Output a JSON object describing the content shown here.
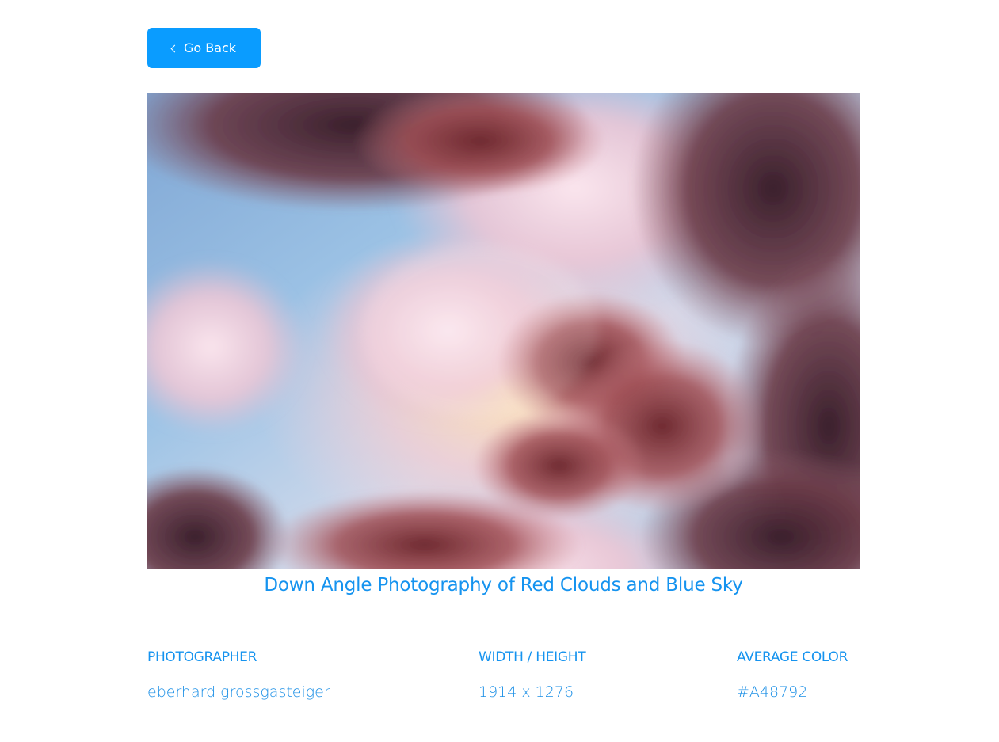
{
  "navigation": {
    "back_label": "Go Back",
    "back_icon": "chevron-left-icon"
  },
  "photo": {
    "title": "Down Angle Photography of Red Clouds and Blue Sky"
  },
  "details": {
    "photographer_label": "PHOTOGRAPHER",
    "photographer_value": "eberhard grossgasteiger",
    "dimensions_label": "WIDTH / HEIGHT",
    "dimensions_value": "1914 x 1276",
    "color_label": "AVERAGE COLOR",
    "color_value": "#A48792"
  },
  "colors": {
    "accent": "#0A9CFF",
    "text_accent": "#1593EF",
    "photo_average": "#A48792"
  }
}
